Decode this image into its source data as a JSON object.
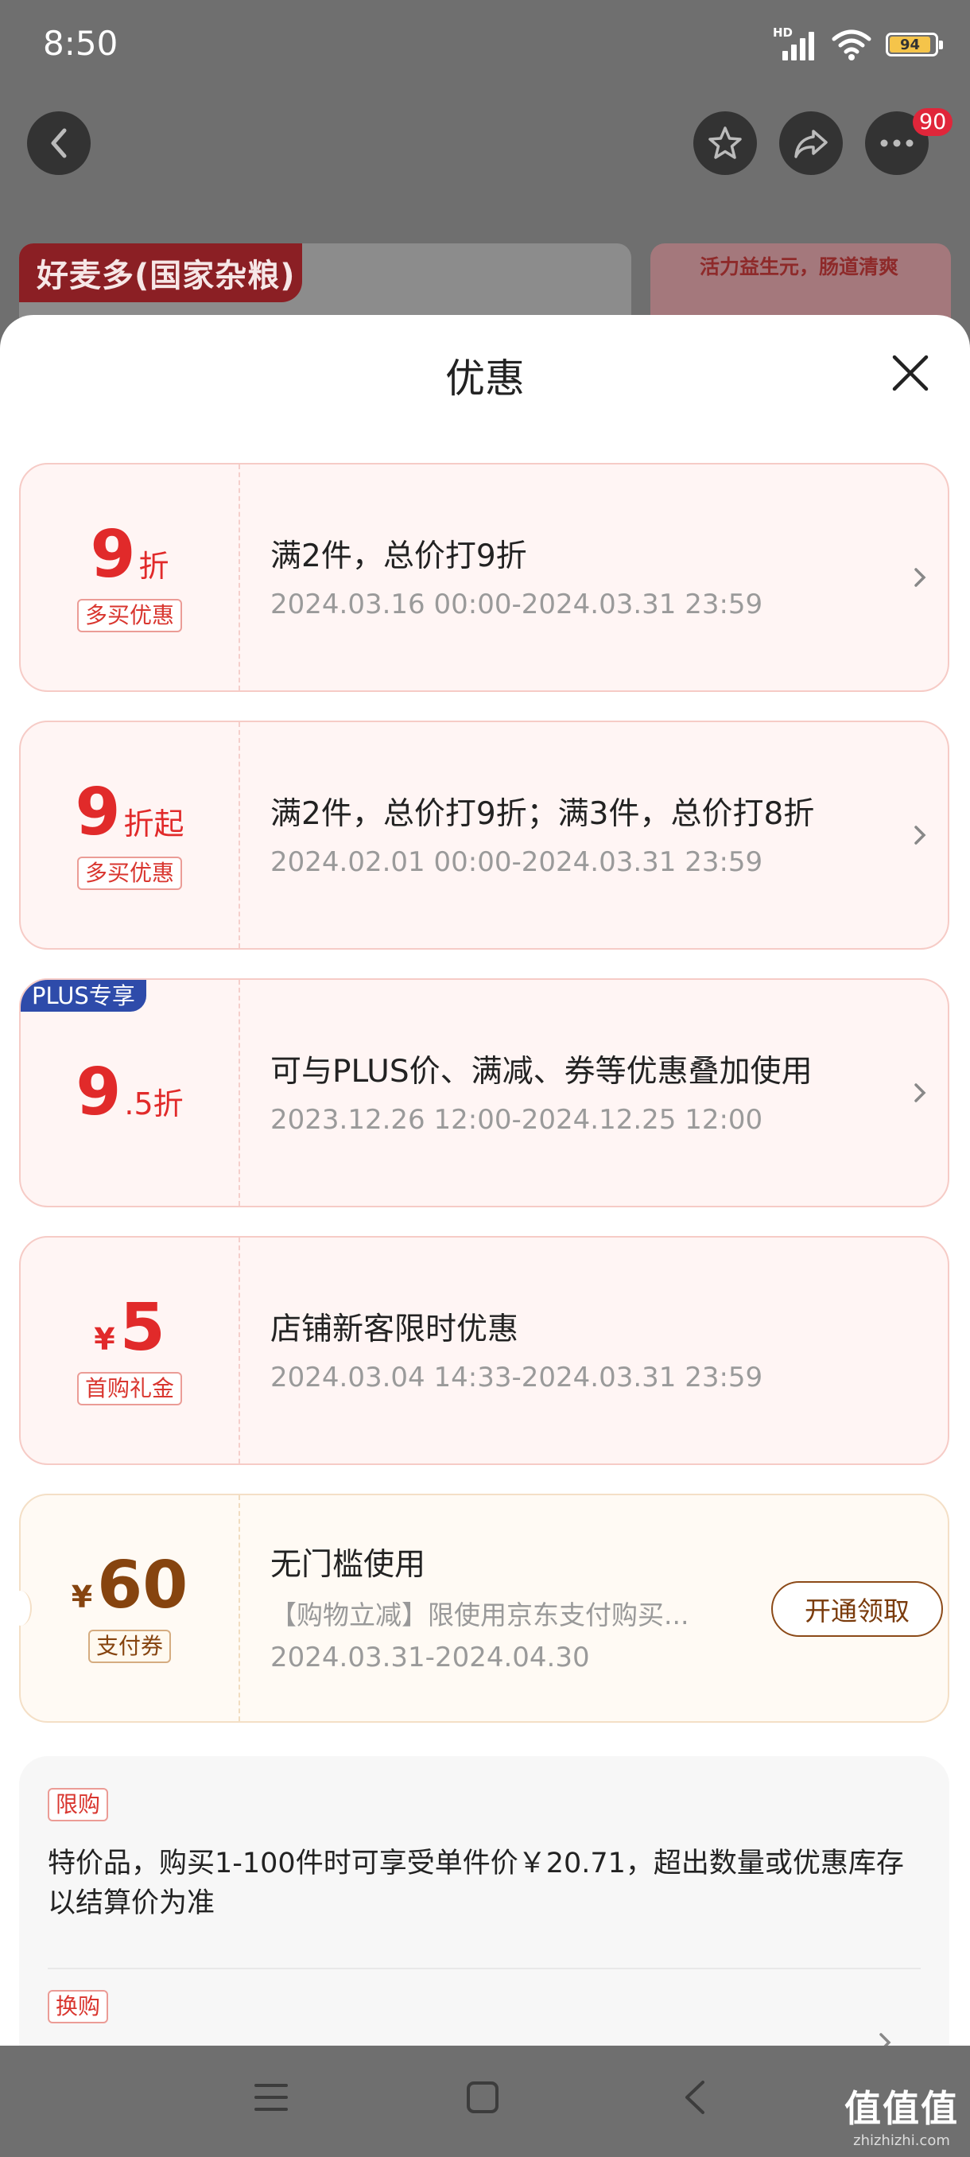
{
  "status_bar": {
    "time": "8:50",
    "network": "HD",
    "battery": "94"
  },
  "nav": {
    "badge_count": "90"
  },
  "banner": {
    "left_tag": "好麦多(国家杂粮)",
    "right_text": "活力益生元，肠道清爽"
  },
  "sheet": {
    "title": "优惠"
  },
  "offers": [
    {
      "amount": "9",
      "unit": "折",
      "tag": "多买优惠",
      "desc": "满2件，总价打9折",
      "date": "2024.03.16 00:00-2024.03.31 23:59"
    },
    {
      "amount": "9",
      "unit": "折起",
      "tag": "多买优惠",
      "desc": "满2件，总价打9折；满3件，总价打8折",
      "date": "2024.02.01 00:00-2024.03.31 23:59"
    },
    {
      "badge": "PLUS专享",
      "amount": "9",
      "unit": ".5折",
      "desc": "可与PLUS价、满减、券等优惠叠加使用",
      "date": "2023.12.26 12:00-2024.12.25 12:00"
    },
    {
      "currency": "¥",
      "amount": "5",
      "tag": "首购礼金",
      "desc": "店铺新客限时优惠",
      "date": "2024.03.04 14:33-2024.03.31 23:59"
    },
    {
      "currency": "¥",
      "amount": "60",
      "tag": "支付券",
      "desc": "无门槛使用",
      "sub": "【购物立减】限使用京东支付购买...",
      "date": "2024.03.31-2024.04.30",
      "button": "开通领取"
    }
  ],
  "rules": [
    {
      "tag": "限购",
      "text": "特价品，购买1-100件时可享受单件价￥20.71，超出数量或优惠库存以结算价为准"
    },
    {
      "tag": "换购"
    }
  ],
  "watermark": {
    "big": "值值值",
    "small": "zhizhizhi.com"
  }
}
